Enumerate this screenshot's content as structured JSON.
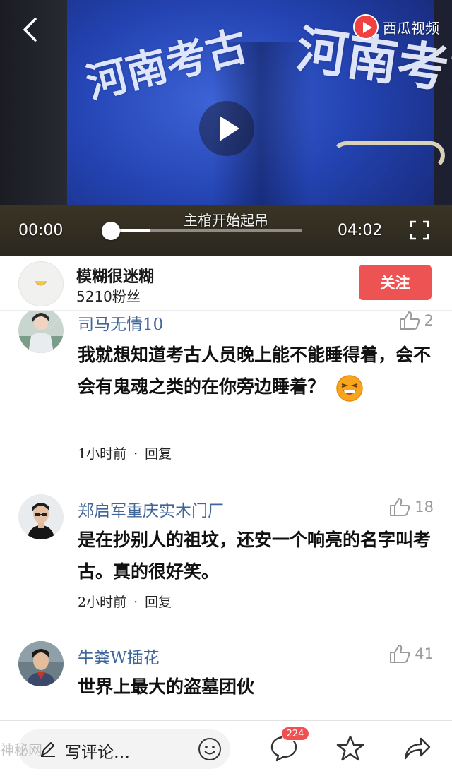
{
  "video": {
    "brand_name": "西瓜视频",
    "brand_logo_icon": "play-logo-icon",
    "back_icon": "chevron-left-icon",
    "play_icon": "play-icon",
    "fullscreen_icon": "fullscreen-icon",
    "subtitle": "主棺开始起吊",
    "printed_text_left": "河南考古",
    "printed_text_right": "河南考古",
    "time_current": "00:00",
    "time_total": "04:02",
    "progress": 0.21
  },
  "author": {
    "name": "模糊很迷糊",
    "fans": "5210粉丝",
    "follow_label": "关注",
    "follow_color": "#ee5353"
  },
  "comments": [
    {
      "name": "司马无情10",
      "likes": "2",
      "body": "我就想知道考古人员晚上能不能睡得着，会不会有鬼魂之类的在你旁边睡着？",
      "emoji": "laughing-face-icon",
      "time": "1小时前",
      "dot": "·",
      "reply": "回复"
    },
    {
      "name": "郑启军重庆实木门厂",
      "likes": "18",
      "body": "是在抄别人的祖坟，还安一个响亮的名字叫考古。真的很好笑。",
      "time": "2小时前",
      "dot": "·",
      "reply": "回复"
    },
    {
      "name": "牛粪W插花",
      "likes": "41",
      "body": "世界上最大的盗墓团伙",
      "time": "",
      "reply": ""
    }
  ],
  "bottom_bar": {
    "input_placeholder": "写评论…",
    "comment_count": "224",
    "icons": [
      "pen-icon",
      "smile-icon",
      "comment-bubble-icon",
      "star-icon",
      "share-icon"
    ],
    "watermark": "神秘网"
  },
  "colors": {
    "name_color": "#406599",
    "like_color": "#9a9a9a",
    "badge_color": "#f05050"
  }
}
